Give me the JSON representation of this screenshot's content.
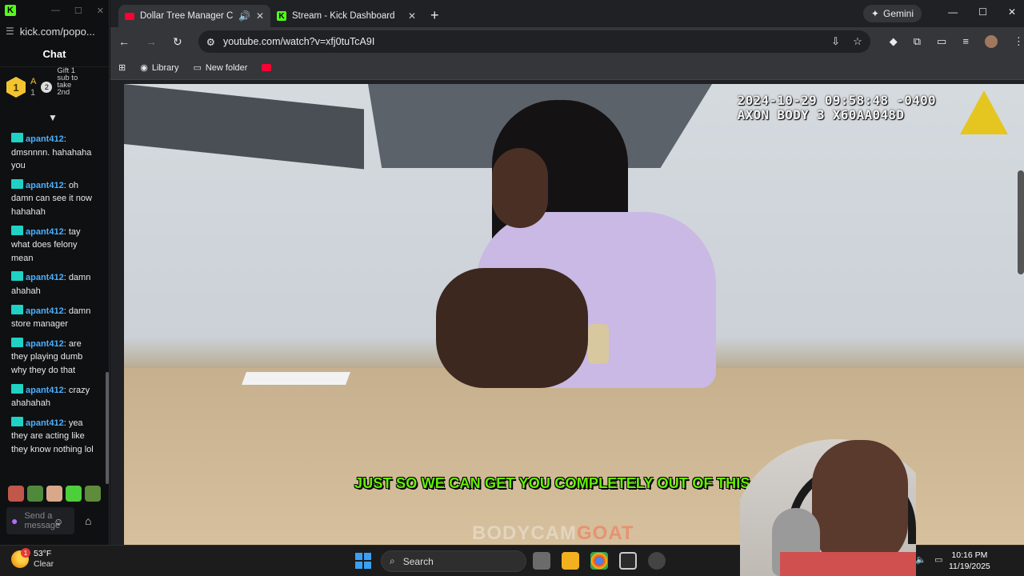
{
  "chat_window": {
    "url": "kick.com/popo...",
    "header": "Chat",
    "pinned": {
      "rank": "1",
      "user_initial": "A",
      "count": "1",
      "gift_text": "Gift 1 sub to take 2nd"
    },
    "messages": [
      {
        "user": "apant412",
        "text": ": dmsnnnn. hahahaha you"
      },
      {
        "user": "apant412",
        "text": ": oh damn can see it now hahahah"
      },
      {
        "user": "apant412",
        "text": ": tay what does felony mean"
      },
      {
        "user": "apant412",
        "text": ": damn ahahah"
      },
      {
        "user": "apant412",
        "text": ": damn store manager"
      },
      {
        "user": "apant412",
        "text": ": are they playing dumb why they do that"
      },
      {
        "user": "apant412",
        "text": ": crazy ahahahah"
      },
      {
        "user": "apant412",
        "text": ": yea they are acting like they know nothing lol"
      }
    ],
    "input_placeholder": "Send a message",
    "colors": {
      "kick_green": "#53fc18",
      "username": "#4bb0ff"
    }
  },
  "browser": {
    "tabs": [
      {
        "title": "Dollar Tree Manager Caught",
        "active": true
      },
      {
        "title": "Stream - Kick Dashboard",
        "active": false
      }
    ],
    "gemini_label": "Gemini",
    "url": "youtube.com/watch?v=xfj0tuTcA9I",
    "bookmarks": [
      {
        "label": "Library"
      },
      {
        "label": "New folder"
      }
    ]
  },
  "video": {
    "timestamp_line1": "2024-10-29 09:58:48 -0400",
    "timestamp_line2": "AXON BODY 3 X60AA048D",
    "subtitle": "JUST SO WE CAN GET YOU COMPLETELY OUT OF THIS",
    "watermark_a": "BODYCAM",
    "watermark_b": "GOAT",
    "subtitle_color": "#64f000"
  },
  "taskbar": {
    "temperature": "53°F",
    "condition": "Clear",
    "weather_badge": "1",
    "search_label": "Search",
    "time": "10:16 PM",
    "date": "11/19/2025"
  }
}
